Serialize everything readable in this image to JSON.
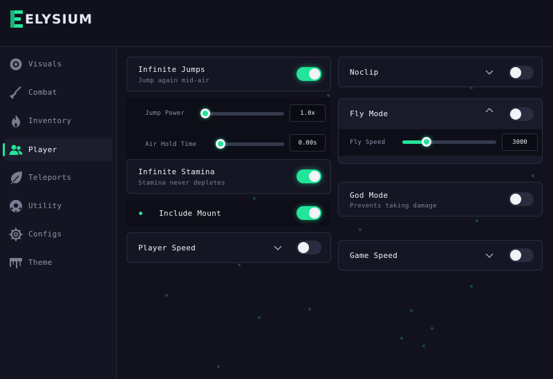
{
  "app": {
    "title": "ELYSIUM",
    "accent": "#22e59a"
  },
  "sidebar": {
    "items": [
      {
        "label": "Visuals",
        "icon": "eye-icon",
        "active": false
      },
      {
        "label": "Combat",
        "icon": "sword-icon",
        "active": false
      },
      {
        "label": "Inventory",
        "icon": "flame-icon",
        "active": false
      },
      {
        "label": "Player",
        "icon": "users-icon",
        "active": true
      },
      {
        "label": "Teleports",
        "icon": "leaf-icon",
        "active": false
      },
      {
        "label": "Utility",
        "icon": "soccer-ball-icon",
        "active": false
      },
      {
        "label": "Configs",
        "icon": "gear-icon",
        "active": false
      },
      {
        "label": "Theme",
        "icon": "paint-drip-icon",
        "active": false
      }
    ]
  },
  "left": {
    "infinite_jumps": {
      "title": "Infinite Jumps",
      "subtitle": "Jump again mid-air",
      "enabled": true,
      "jump_power": {
        "label": "Jump Power",
        "value": "1.0x",
        "level": 0
      },
      "air_hold_time": {
        "label": "Air Hold Time",
        "value": "0.00s",
        "level": 0
      }
    },
    "infinite_stamina": {
      "title": "Infinite Stamina",
      "subtitle": "Stamina never depletes",
      "enabled": true
    },
    "include_mount": {
      "title": "Include Mount",
      "enabled": true
    },
    "player_speed": {
      "title": "Player Speed",
      "enabled": false
    }
  },
  "right": {
    "noclip": {
      "title": "Noclip",
      "enabled": false
    },
    "fly_mode": {
      "title": "Fly Mode",
      "enabled": false,
      "fly_speed": {
        "label": "Fly Speed",
        "value": "3000",
        "level": 0.26
      }
    },
    "god_mode": {
      "title": "God Mode",
      "subtitle": "Prevents taking damage",
      "enabled": false
    },
    "game_speed": {
      "title": "Game Speed",
      "enabled": false
    }
  }
}
